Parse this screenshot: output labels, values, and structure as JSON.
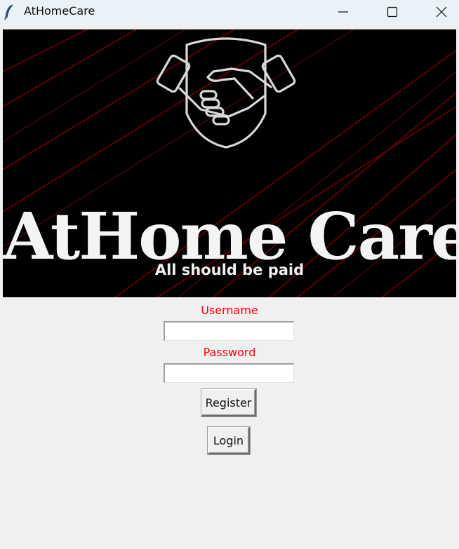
{
  "window": {
    "title": "AtHomeCare",
    "icons": {
      "app": "feather-icon",
      "minimize": "minimize-icon",
      "maximize": "maximize-icon",
      "close": "close-icon"
    }
  },
  "banner": {
    "brand": "AtHome Care",
    "tagline": "All should be paid",
    "logo_icon": "handshake-shield-icon",
    "background_color": "#000000",
    "streak_color": "#8b0000"
  },
  "form": {
    "username_label": "Username",
    "username_value": "",
    "password_label": "Password",
    "password_value": "",
    "label_color": "#ff0000",
    "register_label": "Register",
    "login_label": "Login"
  }
}
